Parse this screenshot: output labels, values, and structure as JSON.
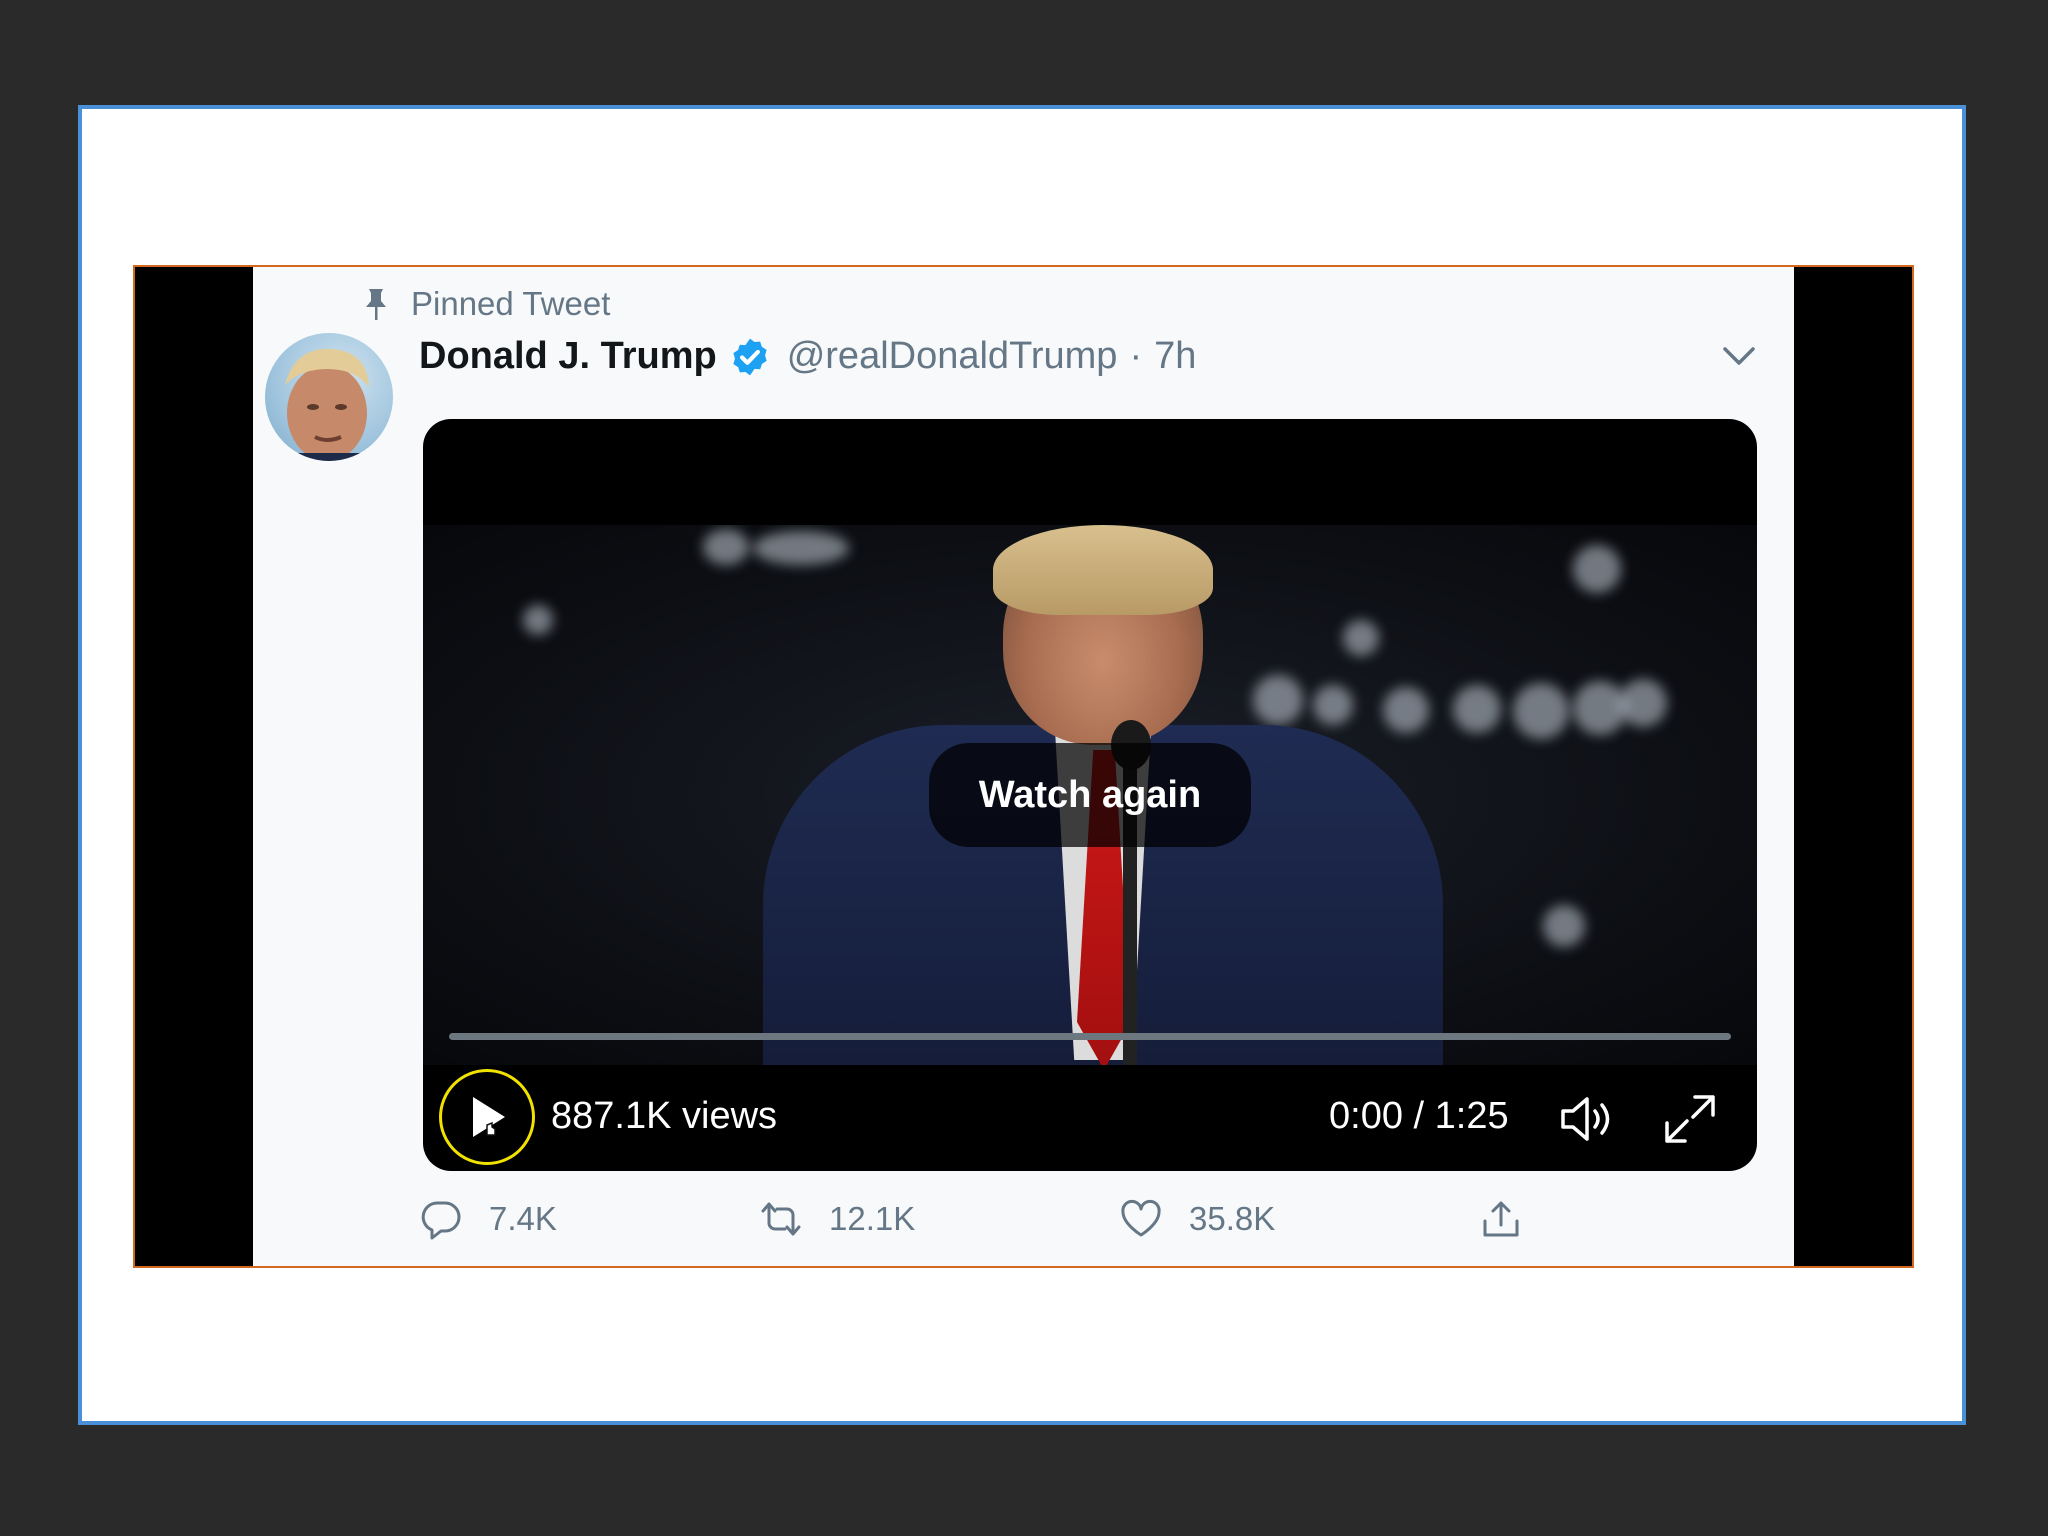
{
  "tweet": {
    "pinned_label": "Pinned Tweet",
    "display_name": "Donald J. Trump",
    "handle": "@realDonaldTrump",
    "separator": "·",
    "time": "7h",
    "verified": true
  },
  "video": {
    "overlay_label": "Watch again",
    "views": "887.1K views",
    "timecode": "0:00 / 1:25",
    "progress": 0.0
  },
  "actions": {
    "reply_count": "7.4K",
    "retweet_count": "12.1K",
    "like_count": "35.8K"
  },
  "icons": {
    "pin": "pin-icon",
    "verified": "verified-icon",
    "caret": "chevron-down-icon",
    "play": "play-icon",
    "volume": "volume-icon",
    "fullscreen": "fullscreen-icon",
    "reply": "reply-icon",
    "retweet": "retweet-icon",
    "like": "heart-icon",
    "share": "share-icon"
  },
  "colors": {
    "frame_border": "#4a90d9",
    "stage_border": "#d2691e",
    "verified_blue": "#1da1f2",
    "muted_text": "#657786",
    "cursor_highlight": "#f2e200"
  }
}
